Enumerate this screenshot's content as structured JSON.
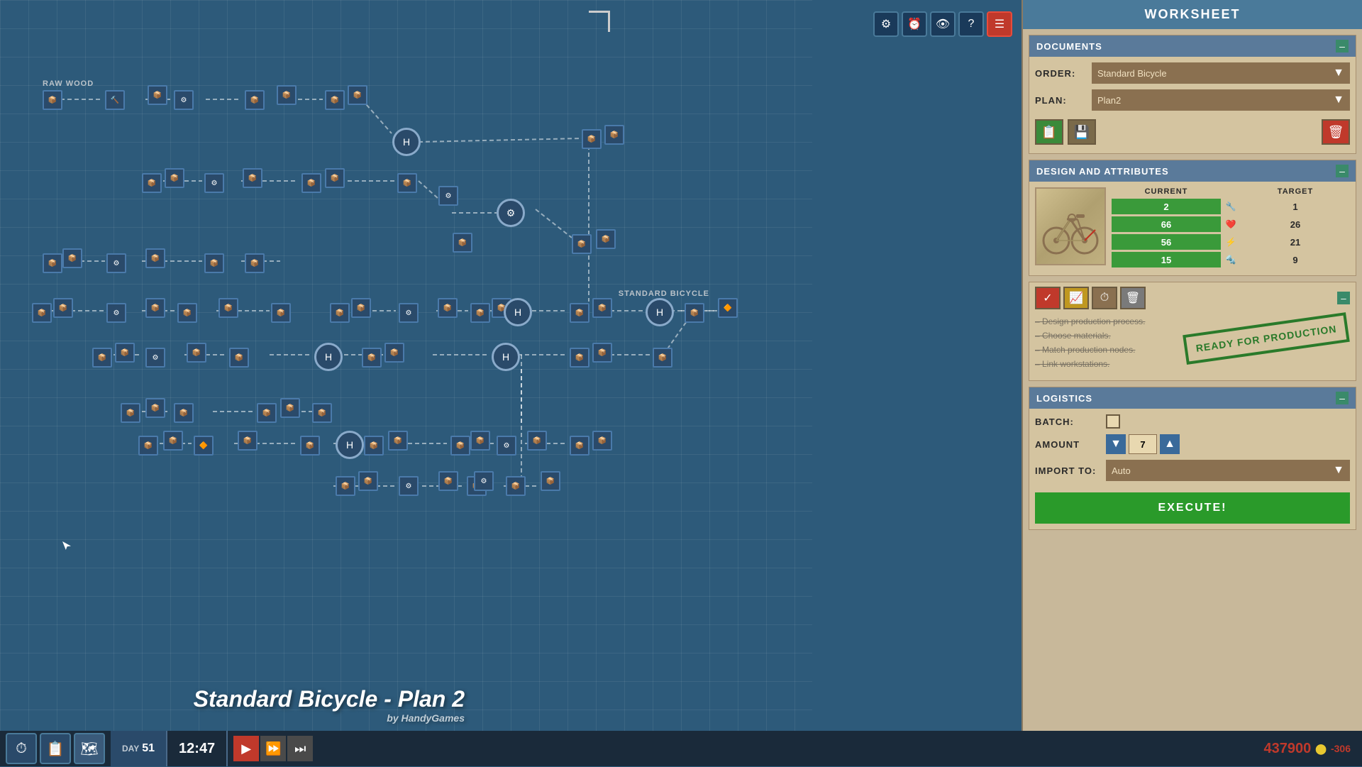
{
  "app": {
    "title": "Standard Bicycle - Plan 2",
    "subtitle": "by HandyGames",
    "canvas_label": "STANDARD BICYCLE"
  },
  "toolbar": {
    "buttons": [
      "⚙",
      "⏰",
      "👁",
      "?"
    ],
    "menu_label": "☰"
  },
  "worksheet": {
    "title": "WORKSHEET",
    "documents_section": {
      "title": "DOCUMENTS",
      "order_label": "ORDER:",
      "order_value": "Standard Bicycle",
      "plan_label": "PLAN:",
      "plan_value": "Plan2",
      "actions": [
        "copy",
        "paste",
        "delete"
      ]
    },
    "design_section": {
      "title": "DESIGN AND ATTRIBUTES",
      "current_label": "CURRENT",
      "target_label": "TARGET",
      "stats": [
        {
          "current": "2",
          "current_color": "green",
          "target": "1"
        },
        {
          "current": "66",
          "current_color": "green",
          "target": "26"
        },
        {
          "current": "56",
          "current_color": "green",
          "target": "21"
        },
        {
          "current": "15",
          "current_color": "green",
          "target": "9"
        }
      ]
    },
    "checklist_section": {
      "items": [
        "– Design production process.",
        "– Choose materials.",
        "– Match production nodes.",
        "– Link workstations."
      ],
      "stamp": "READY FOR PRODUCTION"
    },
    "logistics_section": {
      "title": "LOGISTICS",
      "batch_label": "BATCH:",
      "amount_label": "AMOUNT",
      "import_label": "IMPORT TO:",
      "import_value": "Auto",
      "amount_value": "7",
      "execute_label": "EXECUTE!"
    }
  },
  "status_bar": {
    "day_label": "DAY",
    "day_value": "51",
    "time_value": "12:47",
    "money_value": "437900",
    "money_icon": "⬤",
    "money_change": "-306",
    "play_buttons": [
      "▶",
      "⏩",
      "⏭"
    ]
  },
  "icons": {
    "settings": "⚙",
    "clock": "⏰",
    "eye": "👁",
    "help": "?",
    "menu": "☰",
    "copy": "📋",
    "save": "💾",
    "delete": "🗑",
    "checkbox": "✓",
    "down_arrow": "▼",
    "play": "▶",
    "ff": "⏩",
    "fff": "⏭",
    "timer": "⏱",
    "clipboard": "📋",
    "map": "🗺"
  }
}
